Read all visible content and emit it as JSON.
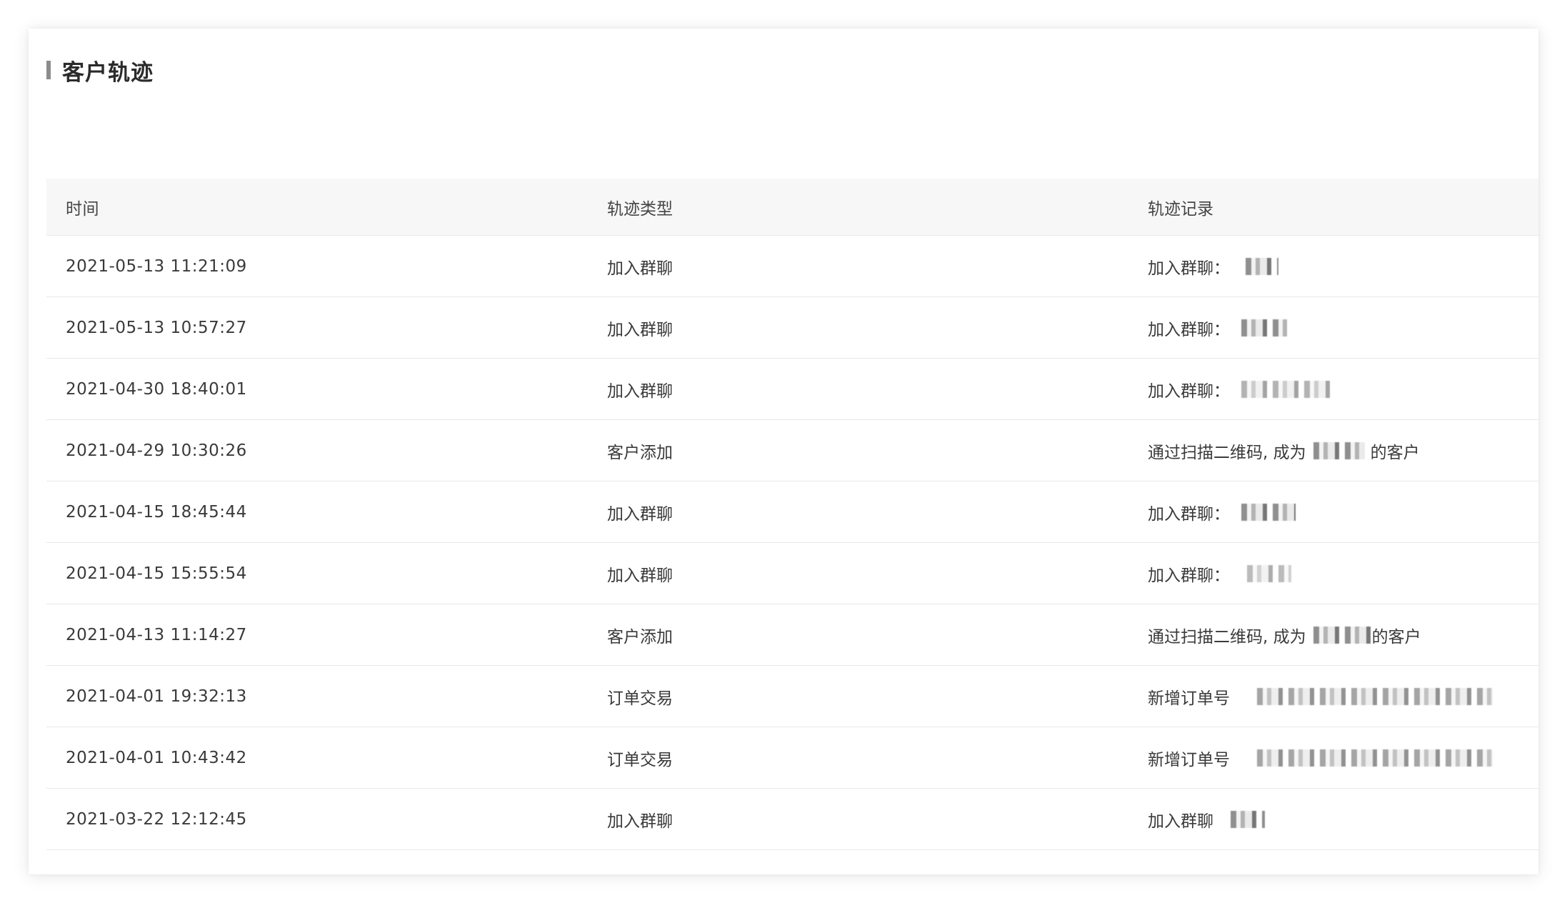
{
  "panel": {
    "title": "客户轨迹"
  },
  "table": {
    "headers": [
      "时间",
      "轨迹类型",
      "轨迹记录"
    ],
    "rows": [
      {
        "time": "2021-05-13 11:21:09",
        "type": "加入群聊",
        "record_prefix": "加入群聊：",
        "record_suffix": ""
      },
      {
        "time": "2021-05-13 10:57:27",
        "type": "加入群聊",
        "record_prefix": "加入群聊：",
        "record_suffix": ""
      },
      {
        "time": "2021-04-30 18:40:01",
        "type": "加入群聊",
        "record_prefix": "加入群聊：",
        "record_suffix": ""
      },
      {
        "time": "2021-04-29 10:30:26",
        "type": "客户添加",
        "record_prefix": "通过扫描二维码, 成为",
        "record_suffix": "的客户"
      },
      {
        "time": "2021-04-15 18:45:44",
        "type": "加入群聊",
        "record_prefix": "加入群聊：",
        "record_suffix": ""
      },
      {
        "time": "2021-04-15 15:55:54",
        "type": "加入群聊",
        "record_prefix": "加入群聊：",
        "record_suffix": ""
      },
      {
        "time": "2021-04-13 11:14:27",
        "type": "客户添加",
        "record_prefix": "通过扫描二维码, 成为",
        "record_suffix": "的客户"
      },
      {
        "time": "2021-04-01 19:32:13",
        "type": "订单交易",
        "record_prefix": "新增订单号",
        "record_suffix": ""
      },
      {
        "time": "2021-04-01 10:43:42",
        "type": "订单交易",
        "record_prefix": "新增订单号",
        "record_suffix": ""
      },
      {
        "time": "2021-03-22 12:12:45",
        "type": "加入群聊",
        "record_prefix": "加入群聊",
        "record_suffix": ""
      }
    ]
  }
}
